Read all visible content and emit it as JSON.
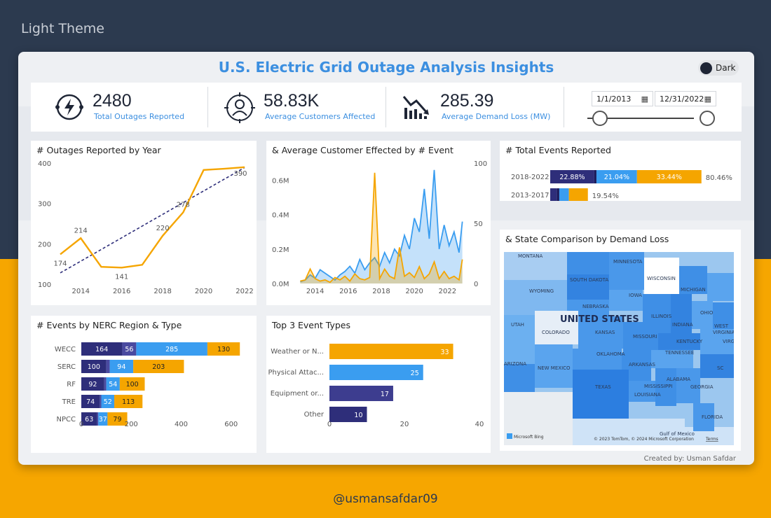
{
  "theme_label": "Light Theme",
  "footer_handle": "@usmansafdar09",
  "header": {
    "title": "U.S. Electric Grid Outage Analysis Insights",
    "toggle_label": "Dark"
  },
  "kpis": [
    {
      "value": "2480",
      "label": "Total Outages Reported",
      "icon": "power-plug-icon"
    },
    {
      "value": "58.83K",
      "label": "Average Customers Affected",
      "icon": "person-target-icon"
    },
    {
      "value": "285.39",
      "label": "Average Demand Loss (MW)",
      "icon": "declining-chart-icon"
    }
  ],
  "date_filter": {
    "start": "1/1/2013",
    "end": "12/31/2022",
    "calendar_icon": "calendar-icon"
  },
  "credit": "Created by: Usman Safdar",
  "colors": {
    "navy": "#2e2e7a",
    "blue": "#3a9df0",
    "orange": "#f5a500",
    "accent_title": "#3c8fe0",
    "background_top": "#2c3a4f",
    "background_bottom": "#f6a600"
  },
  "chart_data": [
    {
      "id": "outages_by_year",
      "type": "line",
      "title": "# Outages Reported by Year",
      "x": [
        2013,
        2014,
        2015,
        2016,
        2017,
        2018,
        2019,
        2020,
        2021,
        2022
      ],
      "x_ticks": [
        "2014",
        "2016",
        "2018",
        "2020",
        "2022"
      ],
      "y_ticks": [
        "100",
        "200",
        "300",
        "400"
      ],
      "ylim": [
        100,
        400
      ],
      "series": [
        {
          "values": [
            174,
            214,
            143,
            141,
            148,
            220,
            278,
            383,
            386,
            390
          ]
        },
        {
          "trend": true,
          "values": [
            128,
            157,
            186,
            215,
            244,
            273,
            302,
            331,
            360,
            389
          ]
        }
      ],
      "data_labels": [
        {
          "x": 2013,
          "text": "174"
        },
        {
          "x": 2014,
          "text": "214"
        },
        {
          "x": 2016,
          "text": "141"
        },
        {
          "x": 2018,
          "text": "220"
        },
        {
          "x": 2019,
          "text": "278"
        },
        {
          "x": 2022,
          "text": "390"
        }
      ]
    },
    {
      "id": "avg_customers_by_event",
      "type": "area",
      "title": "& Average Customer Effected by # Event",
      "x_ticks": [
        "2014",
        "2016",
        "2018",
        "2020",
        "2022"
      ],
      "xlim": [
        2013,
        2023
      ],
      "y_ticks_left": [
        "0.0M",
        "0.2M",
        "0.4M",
        "0.6M"
      ],
      "ylim_left": [
        0,
        0.7
      ],
      "y_ticks_right": [
        "0",
        "50",
        "100"
      ],
      "ylim_right": [
        0,
        100
      ],
      "series": [
        {
          "axis": "left",
          "color": "#3a9df0",
          "x": [
            2013.1,
            2013.4,
            2013.7,
            2014.0,
            2014.3,
            2014.6,
            2014.9,
            2015.2,
            2015.5,
            2015.8,
            2016.1,
            2016.4,
            2016.7,
            2017.0,
            2017.3,
            2017.6,
            2017.9,
            2018.2,
            2018.5,
            2018.8,
            2019.1,
            2019.4,
            2019.7,
            2020.0,
            2020.3,
            2020.6,
            2020.9,
            2021.2,
            2021.5,
            2021.8,
            2022.1,
            2022.4,
            2022.7,
            2022.9
          ],
          "values": [
            0.01,
            0.02,
            0.05,
            0.03,
            0.08,
            0.06,
            0.04,
            0.02,
            0.05,
            0.07,
            0.1,
            0.06,
            0.14,
            0.08,
            0.12,
            0.15,
            0.1,
            0.18,
            0.12,
            0.2,
            0.16,
            0.28,
            0.2,
            0.38,
            0.3,
            0.55,
            0.26,
            0.66,
            0.2,
            0.34,
            0.22,
            0.3,
            0.18,
            0.36
          ]
        },
        {
          "axis": "right",
          "color": "#f5a500",
          "x": [
            2013.1,
            2013.4,
            2013.7,
            2014.0,
            2014.3,
            2014.6,
            2014.9,
            2015.2,
            2015.5,
            2015.8,
            2016.1,
            2016.4,
            2016.7,
            2017.0,
            2017.3,
            2017.6,
            2017.9,
            2018.2,
            2018.5,
            2018.8,
            2019.1,
            2019.4,
            2019.7,
            2020.0,
            2020.3,
            2020.6,
            2020.9,
            2021.2,
            2021.5,
            2021.8,
            2022.1,
            2022.4,
            2022.7,
            2022.9
          ],
          "values": [
            2,
            3,
            12,
            4,
            2,
            3,
            1,
            5,
            3,
            6,
            2,
            8,
            4,
            3,
            5,
            92,
            4,
            12,
            6,
            4,
            30,
            6,
            9,
            5,
            14,
            4,
            8,
            18,
            4,
            10,
            4,
            6,
            3,
            20
          ]
        }
      ]
    },
    {
      "id": "total_events",
      "type": "bar",
      "title": "# Total Events Reported",
      "categories": [
        "2018-2022",
        "2013-2017"
      ],
      "series": [
        {
          "color": "#2e2e7a",
          "values": [
            22.88,
            3.5
          ]
        },
        {
          "color": "#1a1a5a",
          "values": [
            1.1,
            1.2
          ]
        },
        {
          "color": "#3a9df0",
          "values": [
            21.04,
            5.0
          ]
        },
        {
          "color": "#f5a500",
          "values": [
            33.44,
            9.84
          ]
        }
      ],
      "segment_labels": [
        [
          "22.88%",
          "",
          "21.04%",
          "33.44%"
        ],
        [
          "",
          "",
          "",
          ""
        ]
      ],
      "totals": [
        "80.46%",
        "19.54%"
      ]
    },
    {
      "id": "events_by_nerc",
      "type": "bar",
      "title": "# Events by NERC Region & Type",
      "categories": [
        "WECC",
        "SERC",
        "RF",
        "TRE",
        "NPCC"
      ],
      "series": [
        {
          "color": "#2e2e7a",
          "values": [
            164,
            100,
            92,
            74,
            63
          ]
        },
        {
          "color": "#4a4aa0",
          "values": [
            56,
            14,
            8,
            6,
            5
          ]
        },
        {
          "color": "#3a9df0",
          "values": [
            285,
            94,
            54,
            52,
            37
          ]
        },
        {
          "color": "#f5a500",
          "values": [
            130,
            203,
            100,
            113,
            79
          ]
        }
      ],
      "segment_labels": [
        [
          "164",
          "100",
          "92",
          "74",
          "63"
        ],
        [
          "56",
          "",
          "",
          "",
          ""
        ],
        [
          "285",
          "94",
          "54",
          "52",
          "37"
        ],
        [
          "130",
          "203",
          "100",
          "113",
          "79"
        ]
      ],
      "x_ticks": [
        "0",
        "200",
        "400",
        "600"
      ],
      "xlim": [
        0,
        640
      ]
    },
    {
      "id": "top3_event_types",
      "type": "bar",
      "title": "Top 3 Event Types",
      "categories": [
        "Weather or N...",
        "Physical Attac...",
        "Equipment or...",
        "Other"
      ],
      "values": [
        33,
        25,
        17,
        10
      ],
      "colors": [
        "#f5a500",
        "#3a9df0",
        "#3d3d8f",
        "#2e2e7a"
      ],
      "x_ticks": [
        "0",
        "20",
        "40"
      ],
      "xlim": [
        0,
        40
      ]
    }
  ],
  "state_map": {
    "title": "& State Comparison by Demand Loss",
    "country_label": "UNITED STATES",
    "states": [
      "MONTANA",
      "MINNESOTA",
      "WISCONSIN",
      "MICHIGAN",
      "SOUTH DAKOTA",
      "WYOMING",
      "IOWA",
      "NEBRASKA",
      "ILLINOIS",
      "OHIO",
      "UTAH",
      "COLORADO",
      "KANSAS",
      "MISSOURI",
      "INDIANA",
      "KENTUCKY",
      "WEST VIRGINIA",
      "VIRG",
      "OKLAHOMA",
      "ARKANSAS",
      "TENNESSEE",
      "ARIZONA",
      "NEW MEXICO",
      "TEXAS",
      "MISSISSIPPI",
      "ALABAMA",
      "GEORGIA",
      "LOUISIANA",
      "SC",
      "FLORIDA",
      "Gulf of Mexico"
    ],
    "attribution_left": "Microsoft Bing",
    "attribution_right": "© 2023 TomTom, © 2024 Microsoft Corporation",
    "terms": "Terms"
  }
}
